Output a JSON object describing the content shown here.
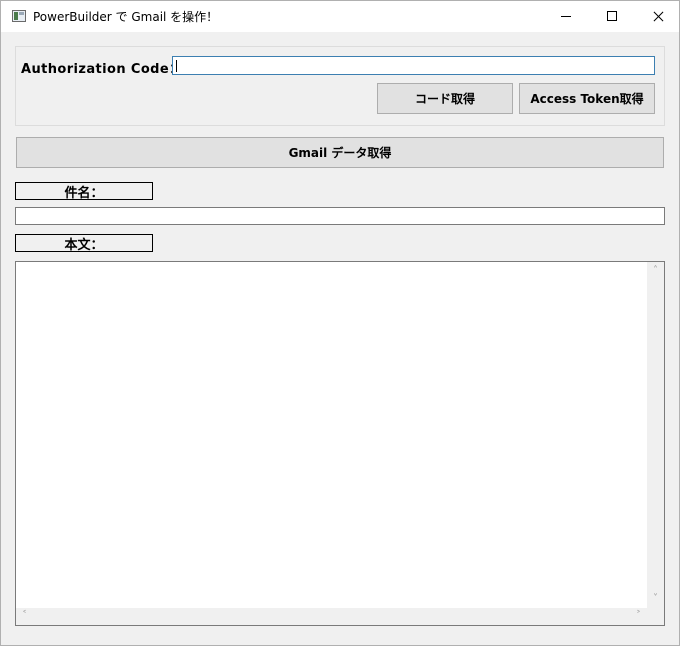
{
  "window": {
    "title": "PowerBuilder で Gmail を操作！",
    "icon": "app-window-icon",
    "controls": [
      "minimize-icon",
      "maximize-icon",
      "close-icon"
    ]
  },
  "auth": {
    "label": "Authorization Code：",
    "value": "",
    "get_code_button": "コード取得",
    "get_token_button": "Access Token取得"
  },
  "gmail_button": "Gmail データ取得",
  "subject": {
    "label": "件名：",
    "value": ""
  },
  "body": {
    "label": "本文：",
    "value": ""
  },
  "scrollbar_arrows": {
    "up": "˄",
    "down": "˅",
    "left": "˂",
    "right": "˃"
  },
  "colors": {
    "window_bg": "#f0f0f0",
    "focus_border": "#3c7fb1",
    "button_face": "#e1e1e1"
  }
}
